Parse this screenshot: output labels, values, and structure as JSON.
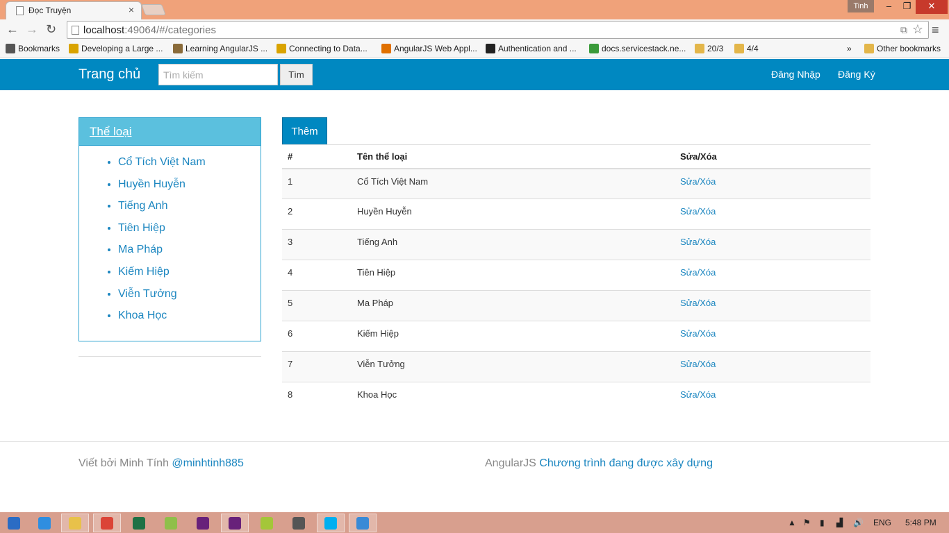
{
  "browser": {
    "tab_title": "Đọc Truyện",
    "user_badge": "Tinh",
    "url_host": "localhost",
    "url_rest": ":49064/#/categories",
    "bookmarks": [
      {
        "label": "Bookmarks",
        "icon": "star-icon",
        "color": "#555555"
      },
      {
        "label": "Developing a Large ...",
        "icon": "sitepoint-icon",
        "color": "#d9a300"
      },
      {
        "label": "Learning AngularJS ...",
        "icon": "books-icon",
        "color": "#8a6b3a"
      },
      {
        "label": "Connecting to Data...",
        "icon": "sitepoint-icon",
        "color": "#d9a300"
      },
      {
        "label": "AngularJS Web Appl...",
        "icon": "packt-icon",
        "color": "#e07000"
      },
      {
        "label": "Authentication and ...",
        "icon": "github-icon",
        "color": "#222222"
      },
      {
        "label": "docs.servicestack.ne...",
        "icon": "servicestack-icon",
        "color": "#3a9a3a"
      },
      {
        "label": "20/3",
        "icon": "folder-icon",
        "color": "#e3b64a"
      },
      {
        "label": "4/4",
        "icon": "folder-icon",
        "color": "#e3b64a"
      }
    ],
    "overflow_label": "»",
    "other_bookmarks": "Other bookmarks"
  },
  "navbar": {
    "brand": "Trang chủ",
    "search_placeholder": "Tìm kiếm",
    "search_button": "Tìm",
    "login": "Đăng Nhập",
    "register": "Đăng Ký"
  },
  "sidebar": {
    "heading": "Thể loại",
    "items": [
      "Cổ Tích Việt Nam",
      "Huyền Huyễn",
      "Tiếng Anh",
      "Tiên Hiệp",
      "Ma Pháp",
      "Kiếm Hiệp",
      "Viễn Tưởng",
      "Khoa Học"
    ]
  },
  "main": {
    "add_button": "Thêm",
    "columns": [
      "#",
      "Tên thể loại",
      "Sửa/Xóa"
    ],
    "rows": [
      {
        "id": "1",
        "name": "Cổ Tích Việt Nam",
        "action": "Sửa/Xóa"
      },
      {
        "id": "2",
        "name": "Huyền Huyễn",
        "action": "Sửa/Xóa"
      },
      {
        "id": "3",
        "name": "Tiếng Anh",
        "action": "Sửa/Xóa"
      },
      {
        "id": "4",
        "name": "Tiên Hiệp",
        "action": "Sửa/Xóa"
      },
      {
        "id": "5",
        "name": "Ma Pháp",
        "action": "Sửa/Xóa"
      },
      {
        "id": "6",
        "name": "Kiếm Hiệp",
        "action": "Sửa/Xóa"
      },
      {
        "id": "7",
        "name": "Viễn Tưởng",
        "action": "Sửa/Xóa"
      },
      {
        "id": "8",
        "name": "Khoa Học",
        "action": "Sửa/Xóa"
      }
    ]
  },
  "footer": {
    "left_text": "Viết bởi Minh Tính",
    "left_link": "@minhtinh885",
    "right_text": "AngularJS",
    "right_link": "Chương trình đang được xây dựng"
  },
  "taskbar": {
    "language": "ENG",
    "time": "5:48 PM",
    "apps": [
      {
        "name": "windows-start-icon",
        "color": "#2b6cc4"
      },
      {
        "name": "internet-explorer-icon",
        "color": "#2f8ee0"
      },
      {
        "name": "file-explorer-icon",
        "color": "#e8c14a"
      },
      {
        "name": "chrome-icon",
        "color": "#db4437"
      },
      {
        "name": "excel-icon",
        "color": "#1e7145"
      },
      {
        "name": "notepad-icon",
        "color": "#8fbf4a"
      },
      {
        "name": "visual-studio-icon",
        "color": "#68217a"
      },
      {
        "name": "visual-studio-icon",
        "color": "#68217a"
      },
      {
        "name": "android-icon",
        "color": "#a4c639"
      },
      {
        "name": "calculator-icon",
        "color": "#555555"
      },
      {
        "name": "skype-icon",
        "color": "#00aff0"
      },
      {
        "name": "network-icon",
        "color": "#3a8ad6"
      }
    ]
  }
}
